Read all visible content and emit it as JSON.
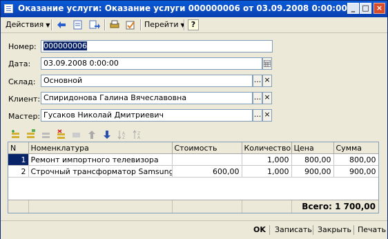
{
  "window": {
    "title": "Оказание услуги: Оказание услуги 000000006 от 03.09.2008 0:00:00",
    "controls": [
      "_",
      "□",
      "×"
    ]
  },
  "toolbar": {
    "actions_label": "Действия",
    "goto_label": "Перейти",
    "help_label": "?",
    "icons": [
      "back-icon",
      "document-icon",
      "copy-forward-icon",
      "print-icon",
      "post-icon"
    ]
  },
  "form": {
    "number_label": "Номер:",
    "number_value": "000000006",
    "date_label": "Дата:",
    "date_value": "03.09.2008  0:00:00",
    "warehouse_label": "Склад:",
    "warehouse_value": "Основной",
    "client_label": "Клиент:",
    "client_value": "Спиридонова Галина Вячеславовна",
    "master_label": "Мастер:",
    "master_value": "Гусаков Николай Дмитриевич",
    "select_button": "...",
    "clear_button": "×"
  },
  "table": {
    "columns": [
      "N",
      "Номенклатура",
      "Стоимость",
      "Количество",
      "Цена",
      "Сумма"
    ],
    "rows": [
      [
        "1",
        "Ремонт импортного телевизора",
        "",
        "1,000",
        "800,00",
        "800,00"
      ],
      [
        "2",
        "Строчный трансформатор Samsung",
        "600,00",
        "1,000",
        "900,00",
        "900,00"
      ]
    ],
    "total_label": "Всего:",
    "total_value": "1 700,00"
  },
  "buttons": {
    "ok": "OK",
    "save": "Записать",
    "close": "Закрыть",
    "print": "Печать"
  },
  "colors": {
    "titlebar": "#0a5bd8",
    "selection": "#0a246a",
    "window_bg": "#ece9d8"
  }
}
